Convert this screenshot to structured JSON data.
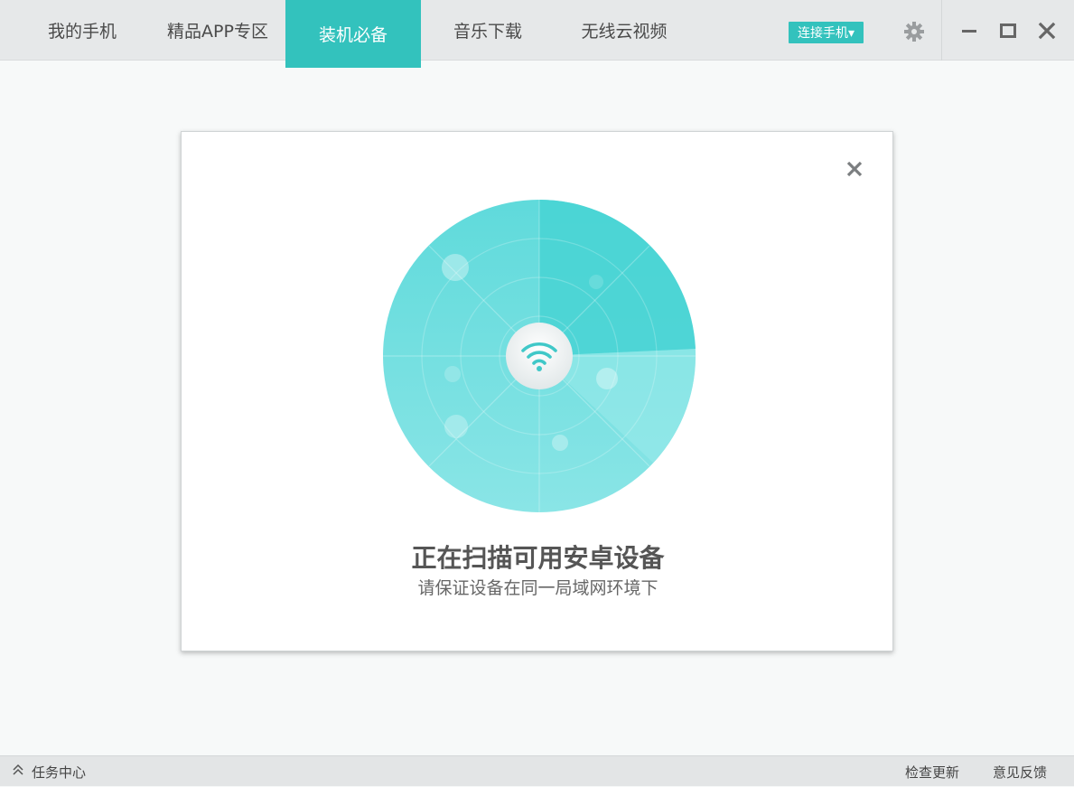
{
  "header": {
    "tabs": [
      {
        "label": "我的手机"
      },
      {
        "label": "精品APP专区"
      },
      {
        "label": "装机必备",
        "active": true
      },
      {
        "label": "音乐下载"
      },
      {
        "label": "无线云视频"
      }
    ],
    "connect_button": "连接手机▾",
    "icons": [
      "gear-icon",
      "minimize-icon",
      "maximize-icon",
      "close-icon"
    ]
  },
  "dialog": {
    "title": "正在扫描可用安卓设备",
    "subtitle": "请保证设备在同一局域网环境下",
    "icons": [
      "close-icon",
      "wifi-icon"
    ]
  },
  "statusbar": {
    "task_center": "任务中心",
    "check_update": "检查更新",
    "feedback": "意见反馈"
  },
  "colors": {
    "accent": "#33c2bd",
    "radar": "#5fd9d9",
    "background": "#f7f9f9"
  }
}
